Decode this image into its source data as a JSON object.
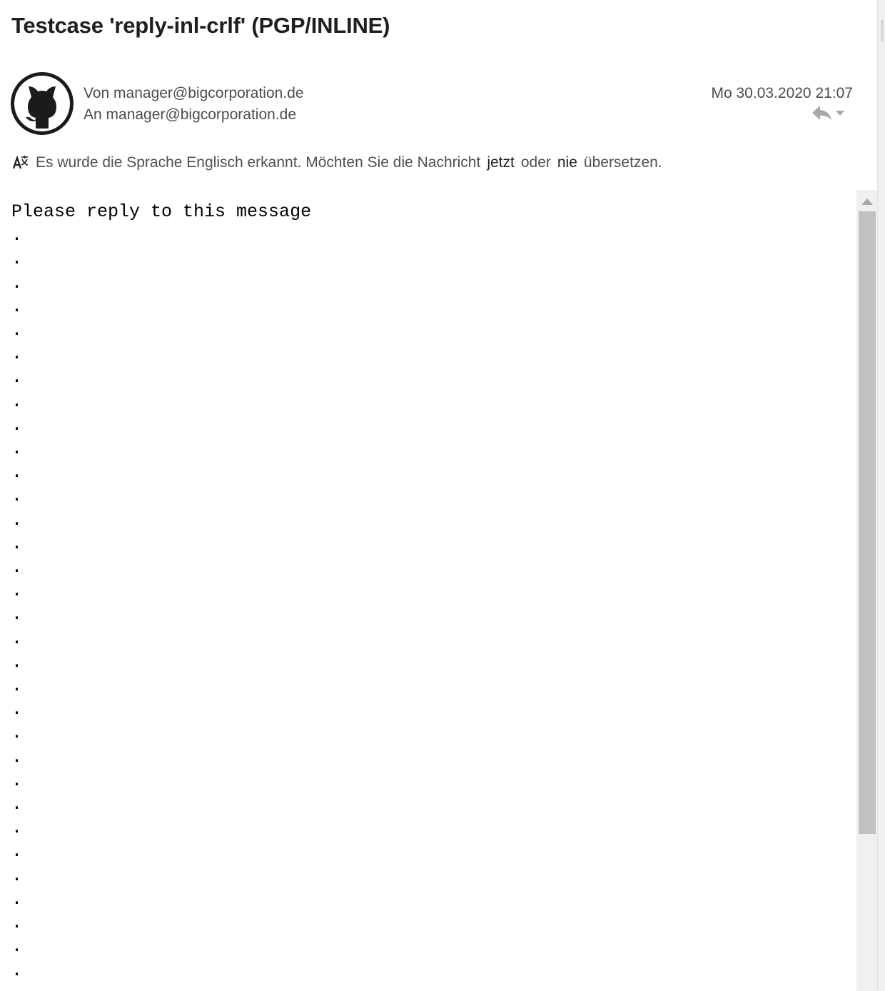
{
  "message": {
    "subject": "Testcase 'reply-inl-crlf' (PGP/INLINE)",
    "from_line": "Von manager@bigcorporation.de",
    "to_line": "An manager@bigcorporation.de",
    "date": "Mo 30.03.2020 21:07",
    "avatar_icon": "github-octocat-icon",
    "reply_icon": "reply-arrow-icon",
    "reply_menu_icon": "chevron-down-icon"
  },
  "translation": {
    "icon": "translate-icon",
    "prefix": "Es wurde die Sprache Englisch erkannt. Möchten Sie die Nachricht",
    "now_link": "jetzt",
    "middle": "oder",
    "never_link": "nie",
    "suffix": "übersetzen."
  },
  "body": {
    "text": "Please reply to this message\n.\n.\n.\n.\n.\n.\n.\n.\n.\n.\n.\n.\n.\n.\n.\n.\n.\n.\n.\n.\n.\n.\n.\n.\n.\n.\n.\n.\n.\n.\n.\n."
  },
  "colors": {
    "subject_text": "#1f1f1f",
    "header_text": "#4d4d4d",
    "scrollbar_thumb": "#c1c1c1",
    "scrollbar_track": "#f0f0f0"
  }
}
